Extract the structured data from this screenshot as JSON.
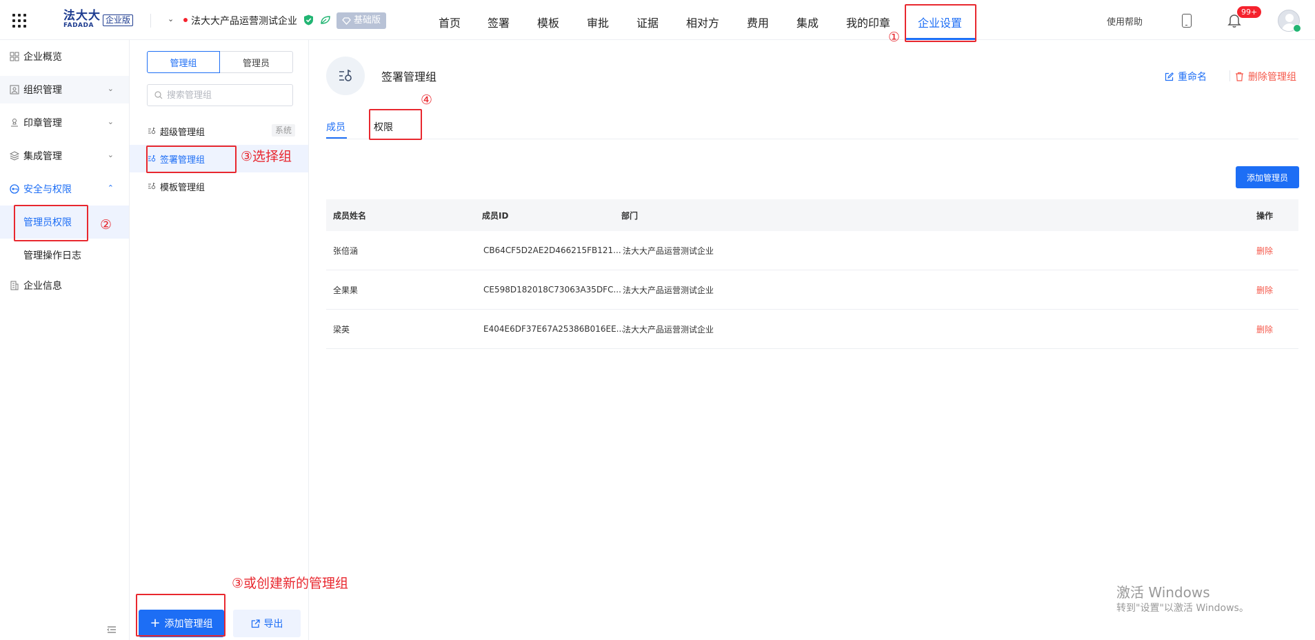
{
  "header": {
    "logo_zh": "法大大",
    "logo_en": "FADADA",
    "edition": "企业版",
    "enterprise_name": "法大大产品运营测试企业",
    "edition_badge": "基础版",
    "nav": [
      {
        "label": "首页"
      },
      {
        "label": "签署"
      },
      {
        "label": "模板"
      },
      {
        "label": "审批"
      },
      {
        "label": "证据"
      },
      {
        "label": "相对方"
      },
      {
        "label": "费用"
      },
      {
        "label": "集成"
      },
      {
        "label": "我的印章"
      },
      {
        "label": "企业设置"
      }
    ],
    "help": "使用帮助",
    "notification_count": "99+"
  },
  "sidebar": {
    "items": [
      {
        "label": "企业概览",
        "icon": "overview-icon"
      },
      {
        "label": "组织管理",
        "icon": "org-icon"
      },
      {
        "label": "印章管理",
        "icon": "seal-icon"
      },
      {
        "label": "集成管理",
        "icon": "layers-icon"
      },
      {
        "label": "安全与权限",
        "icon": "security-icon"
      },
      {
        "label": "企业信息",
        "icon": "building-icon"
      }
    ],
    "sub_items": [
      {
        "label": "管理员权限"
      },
      {
        "label": "管理操作日志"
      }
    ]
  },
  "group_panel": {
    "tabs": [
      {
        "label": "管理组"
      },
      {
        "label": "管理员"
      }
    ],
    "search_placeholder": "搜索管理组",
    "groups": [
      {
        "label": "超级管理组",
        "tag": "系统"
      },
      {
        "label": "签署管理组"
      },
      {
        "label": "模板管理组"
      }
    ],
    "add_button": "添加管理组",
    "export_button": "导出"
  },
  "main": {
    "group_title": "签署管理组",
    "rename": "重命名",
    "delete_group": "删除管理组",
    "tabs": [
      {
        "label": "成员"
      },
      {
        "label": "权限"
      }
    ],
    "add_admin": "添加管理员",
    "columns": [
      "成员姓名",
      "成员ID",
      "部门",
      "操作"
    ],
    "rows": [
      {
        "name": "张倍涵",
        "id": "CB64CF5D2AE2D466215FB121...",
        "dept": "法大大产品运营测试企业",
        "action": "删除"
      },
      {
        "name": "全果果",
        "id": "CE598D182018C73063A35DFC...",
        "dept": "法大大产品运营测试企业",
        "action": "删除"
      },
      {
        "name": "梁英",
        "id": "E404E6DF37E67A25386B016EE...",
        "dept": "法大大产品运营测试企业",
        "action": "删除"
      }
    ]
  },
  "annotations": {
    "step1": "①",
    "step2": "②",
    "step3_select": "③选择组",
    "step3_create": "③或创建新的管理组",
    "step4": "④"
  },
  "watermark": {
    "line1": "激活 Windows",
    "line2": "转到\"设置\"以激活 Windows。"
  },
  "colors": {
    "accent": "#1d6ef5",
    "danger": "#f5584a",
    "annotation": "#e8272e"
  }
}
